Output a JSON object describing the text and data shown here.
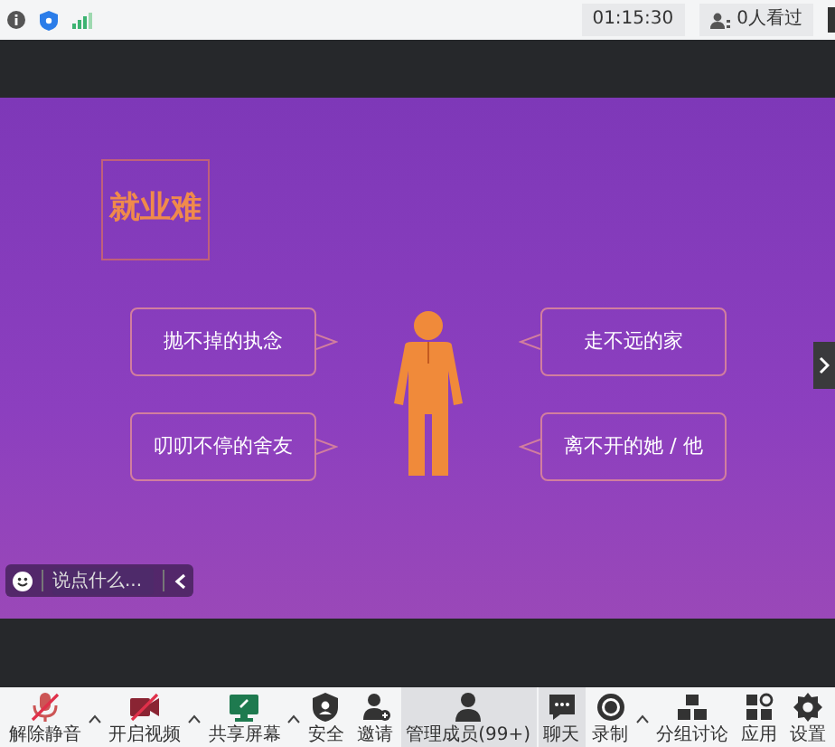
{
  "status_bar": {
    "timer": "01:15:30",
    "viewers": "0人看过"
  },
  "slide": {
    "title": "就业难",
    "bubbles": [
      {
        "text": "抛不掉的执念",
        "kind": "left"
      },
      {
        "text": "走不远的家",
        "kind": "right"
      },
      {
        "text": "叨叨不停的舍友",
        "kind": "left"
      },
      {
        "text": "离不开的她 / 他",
        "kind": "right"
      }
    ]
  },
  "chat_input": {
    "placeholder": "说点什么..."
  },
  "toolbar": [
    {
      "kind": "mic",
      "label": "解除静音",
      "off": true,
      "highlighted": false,
      "caret": true
    },
    {
      "kind": "camera",
      "label": "开启视频",
      "off": true,
      "highlighted": false,
      "caret": true
    },
    {
      "kind": "screen",
      "label": "共享屏幕",
      "off": false,
      "highlighted": false,
      "caret": true
    },
    {
      "kind": "shield",
      "label": "安全",
      "off": false,
      "highlighted": false,
      "caret": false
    },
    {
      "kind": "invite",
      "label": "邀请",
      "off": false,
      "highlighted": false,
      "caret": false
    },
    {
      "kind": "members",
      "label": "管理成员(99+)",
      "off": false,
      "highlighted": true,
      "caret": false
    },
    {
      "kind": "chat",
      "label": "聊天",
      "off": false,
      "highlighted": true,
      "caret": false
    },
    {
      "kind": "record",
      "label": "录制",
      "off": false,
      "highlighted": false,
      "caret": true
    },
    {
      "kind": "groups",
      "label": "分组讨论",
      "off": false,
      "highlighted": false,
      "caret": false
    },
    {
      "kind": "apps",
      "label": "应用",
      "off": false,
      "highlighted": false,
      "caret": false
    },
    {
      "kind": "gear",
      "label": "设置",
      "off": false,
      "highlighted": false,
      "caret": false
    }
  ]
}
